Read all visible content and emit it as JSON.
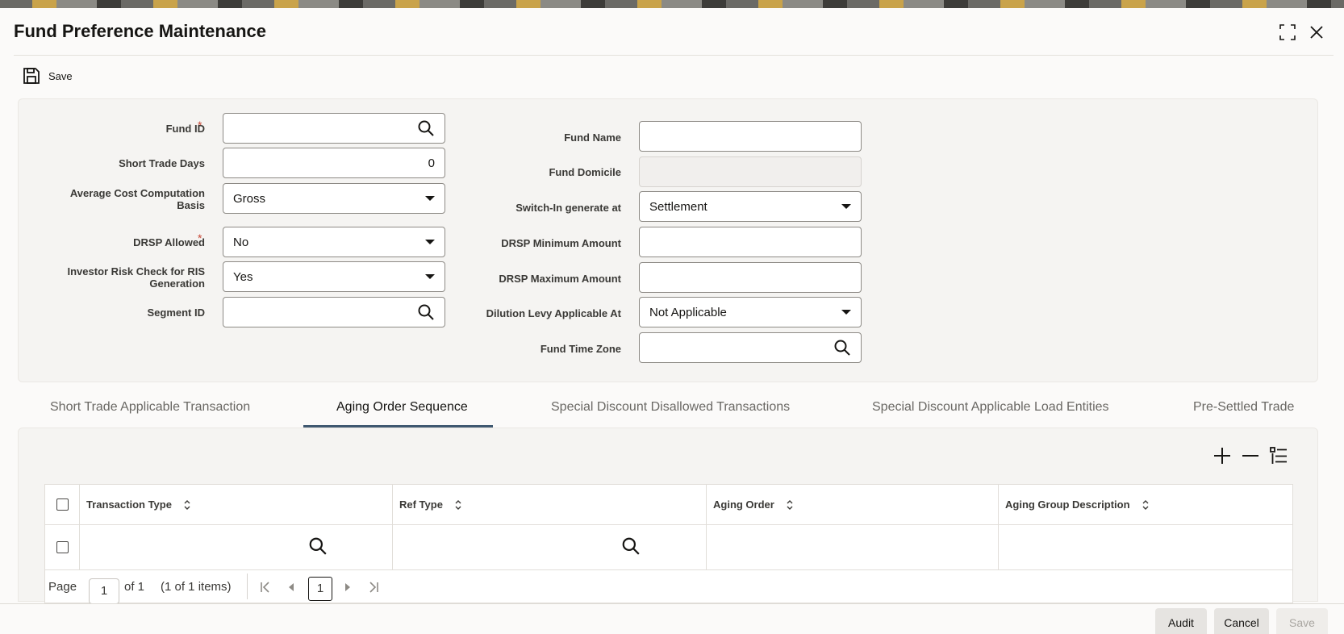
{
  "window": {
    "title": "Fund Preference Maintenance"
  },
  "toolbar": {
    "save_label": "Save"
  },
  "form": {
    "fund_id": {
      "label": "Fund ID",
      "value": ""
    },
    "short_trade_days": {
      "label": "Short Trade Days",
      "value": "0"
    },
    "avg_cost_basis": {
      "label_line1": "Average Cost Computation",
      "label_line2": "Basis",
      "value": "Gross"
    },
    "drsp_allowed": {
      "label": "DRSP Allowed",
      "value": "No"
    },
    "investor_risk": {
      "label_line1": "Investor Risk Check for RIS",
      "label_line2": "Generation",
      "value": "Yes"
    },
    "segment_id": {
      "label": "Segment ID",
      "value": ""
    },
    "fund_name": {
      "label": "Fund Name",
      "value": ""
    },
    "fund_domicile": {
      "label": "Fund Domicile",
      "value": ""
    },
    "switch_in": {
      "label": "Switch-In generate at",
      "value": "Settlement"
    },
    "drsp_min": {
      "label": "DRSP Minimum Amount",
      "value": ""
    },
    "drsp_max": {
      "label": "DRSP Maximum Amount",
      "value": ""
    },
    "dilution_levy": {
      "label": "Dilution Levy Applicable At",
      "value": "Not Applicable"
    },
    "fund_time_zone": {
      "label": "Fund Time Zone",
      "value": ""
    },
    "required_mark": "*"
  },
  "tabs": [
    {
      "label": "Short Trade Applicable Transaction"
    },
    {
      "label": "Aging Order Sequence"
    },
    {
      "label": "Special Discount Disallowed Transactions"
    },
    {
      "label": "Special Discount Applicable Load Entities"
    },
    {
      "label": "Pre-Settled Trade"
    }
  ],
  "active_tab": "Aging Order Sequence",
  "table": {
    "columns": [
      "Transaction Type",
      "Ref Type",
      "Aging Order",
      "Aging Group Description"
    ],
    "rows": [
      {
        "transaction_type": "",
        "ref_type": "",
        "aging_order": "",
        "aging_group_description": ""
      }
    ]
  },
  "pagination": {
    "page_label": "Page",
    "page_value": "1",
    "of_label": "of 1",
    "items_label": "(1 of 1 items)",
    "current_page": "1"
  },
  "footer": {
    "audit_label": "Audit",
    "cancel_label": "Cancel",
    "save_label": "Save"
  },
  "colors": {
    "accent": "#3f5870",
    "required": "#c74634",
    "panel": "#f5f4f2"
  }
}
